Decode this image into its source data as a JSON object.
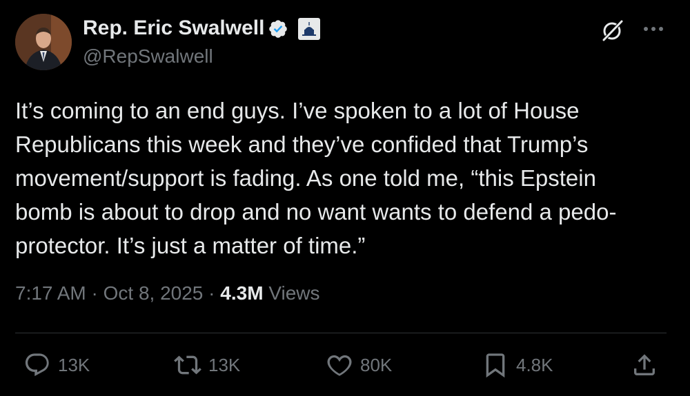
{
  "author": {
    "display_name": "Rep. Eric Swalwell",
    "handle": "@RepSwalwell",
    "verified": true,
    "government_badge": "capitol-icon"
  },
  "tweet": {
    "text_lines": [
      "It’s coming to an end guys. I’ve spoken to a lot of House",
      "Republicans this week and they’ve confided that Trump’s",
      "movement/support is fading. As one told me, “this Epstein",
      "bomb is about to drop and no want wants to defend a pedo-",
      "protector. It’s just a matter of time.”"
    ],
    "time": "7:17 AM",
    "separator": "·",
    "date": "Oct 8, 2025",
    "views_count": "4.3M",
    "views_label": "Views"
  },
  "actions": {
    "replies": "13K",
    "reposts": "13K",
    "likes": "80K",
    "bookmarks": "4.8K"
  },
  "colors": {
    "background": "#000000",
    "text": "#e7e9ea",
    "secondary": "#71767b",
    "verified_blue": "#1d9bf0",
    "divider": "#2f3336"
  }
}
